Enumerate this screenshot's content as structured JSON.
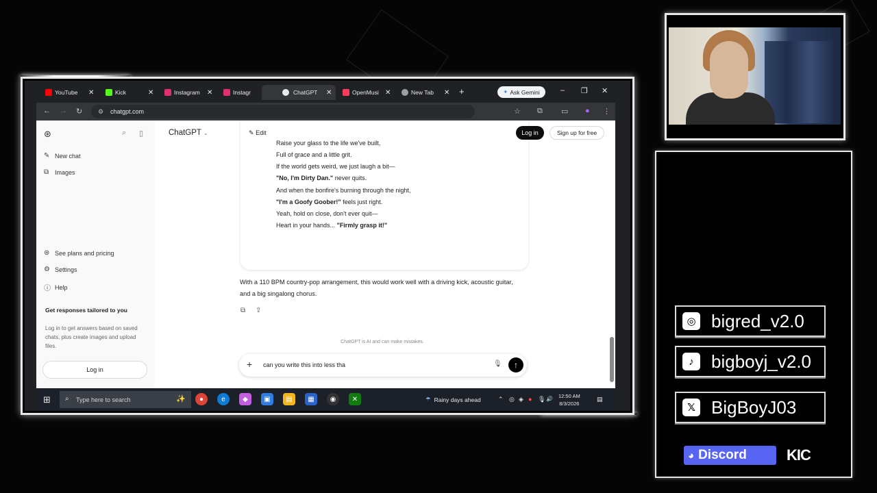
{
  "browser": {
    "tabs": [
      {
        "label": "YouTube",
        "color": "#ff0000"
      },
      {
        "label": "Kick",
        "color": "#53fc18"
      },
      {
        "label": "Instagram",
        "color": "#e1306c"
      },
      {
        "label": "Instagr",
        "color": "#e1306c"
      },
      {
        "label": "ChatGPT",
        "color": "#ffffff"
      },
      {
        "label": "OpenMusi",
        "color": "#ff3b5c"
      },
      {
        "label": "New Tab",
        "color": "#9aa0a6"
      }
    ],
    "new_tab_glyph": "+",
    "gemini_label": "Ask Gemini",
    "url": "chatgpt.com"
  },
  "chatgpt": {
    "sidebar": {
      "new_chat": "New chat",
      "images": "Images",
      "plans": "See plans and pricing",
      "settings": "Settings",
      "help": "Help",
      "promo_title": "Get responses tailored to you",
      "promo_text": "Log in to get answers based on saved chats, plus create images and upload files.",
      "login": "Log in"
    },
    "header": {
      "model": "ChatGPT",
      "edit": "Edit",
      "login": "Log in",
      "signup": "Sign up for free"
    },
    "lyrics": [
      {
        "pre": "Raise your glass to the life we've built,",
        "bold": "",
        "post": ""
      },
      {
        "pre": "Full of grace and a little grit.",
        "bold": "",
        "post": ""
      },
      {
        "pre": "If the world gets weird, we just laugh a bit—",
        "bold": "",
        "post": ""
      },
      {
        "pre": "",
        "bold": "\"No, I'm Dirty Dan.\"",
        "post": " never quits."
      },
      {
        "pre": "And when the bonfire's burning through the night,",
        "bold": "",
        "post": ""
      },
      {
        "pre": "",
        "bold": "\"I'm a Goofy Goober!\"",
        "post": " feels just right."
      },
      {
        "pre": "Yeah, hold on close, don't ever quit—",
        "bold": "",
        "post": ""
      },
      {
        "pre": "Heart in your hands... ",
        "bold": "\"Firmly grasp it!\"",
        "post": ""
      }
    ],
    "reply": "With a 110 BPM country-pop arrangement, this would work well with a driving kick, acoustic guitar, and a big singalong chorus.",
    "disclaimer": "ChatGPT is AI and can make mistakes.",
    "composer_text": "can you write this into less tha"
  },
  "taskbar": {
    "search_placeholder": "Type here to search",
    "weather": "Rainy days ahead",
    "time": "12:50 AM",
    "date": "8/3/2026"
  },
  "overlay": {
    "socials": [
      {
        "icon": "instagram-icon",
        "handle": "bigred_v2.0"
      },
      {
        "icon": "tiktok-icon",
        "handle": "bigboyj_v2.0"
      },
      {
        "icon": "x-icon",
        "handle": "BigBoyJ03"
      }
    ],
    "discord": "Discord",
    "kick": "KIC"
  },
  "colors": {
    "discord": "#5865f2",
    "browser_bg": "#202124",
    "send_button": "#000000"
  }
}
